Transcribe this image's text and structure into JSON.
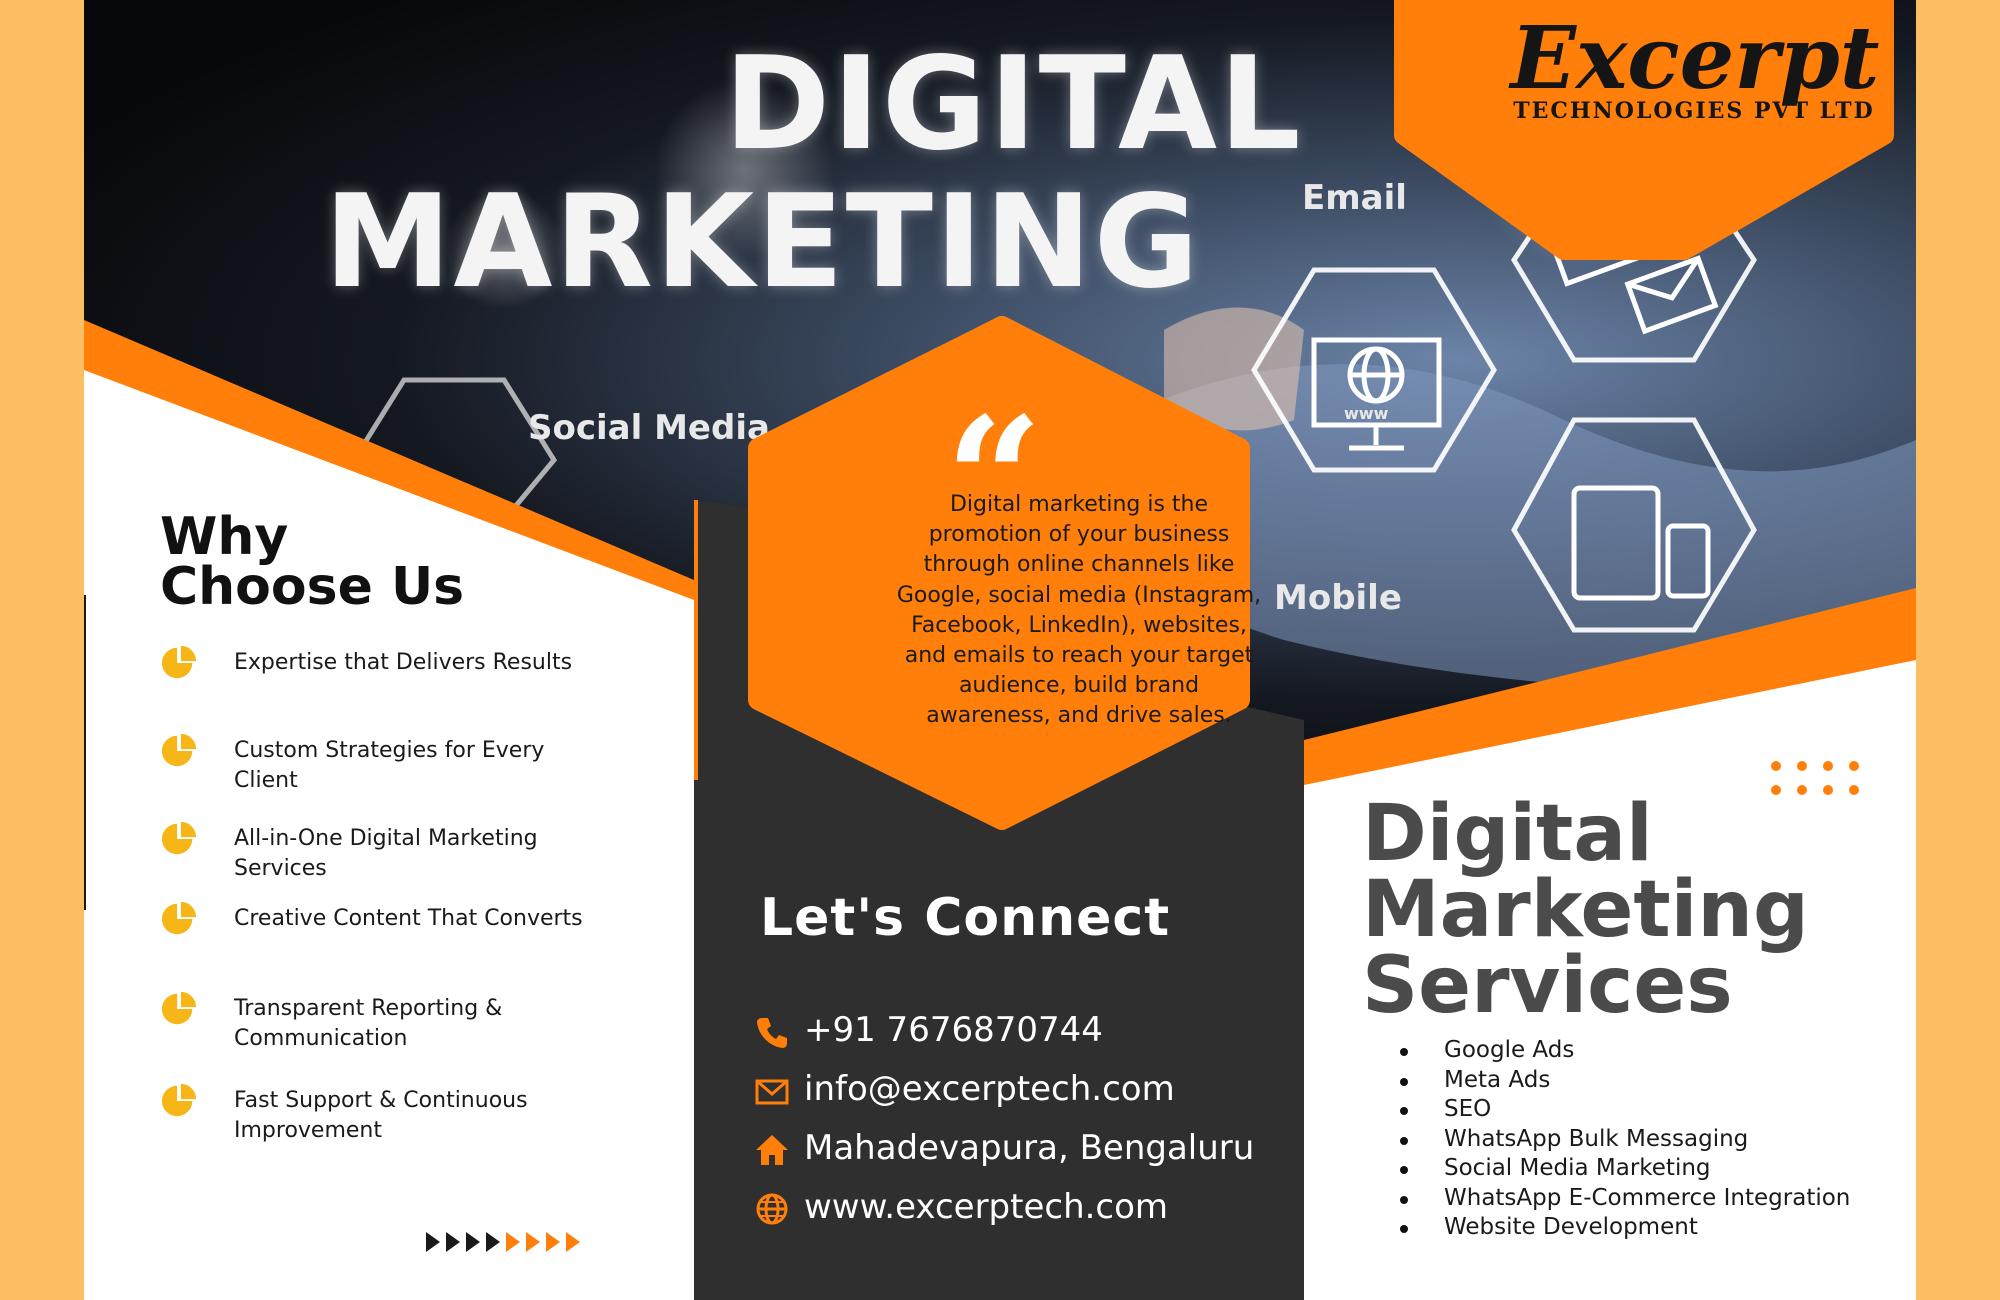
{
  "brand": {
    "logo_title": "Excerpt",
    "logo_subtitle": "TECHNOLOGIES PVT LTD",
    "accent_color": "#ff7f0a",
    "dark_color": "#2f2f2f",
    "yellow_color": "#f7b617"
  },
  "hero": {
    "headline_line1": "DIGITAL",
    "headline_line2": "MARKETING",
    "tags": {
      "email": "Email",
      "social_media": "Social Media",
      "mobile": "Mobile",
      "www": "www"
    }
  },
  "quote": {
    "mark": "“",
    "text": "Digital marketing is the promotion of your business through online channels like Google, social media (Instagram, Facebook, LinkedIn), websites, and emails to reach your target audience, build brand awareness, and drive sales."
  },
  "why_choose_us": {
    "title_line1": "Why",
    "title_line2": "Choose Us",
    "items": [
      {
        "label": "Expertise that Delivers Results",
        "icon": "pie-chart-icon"
      },
      {
        "label": "Custom Strategies for Every Client",
        "icon": "pie-chart-icon"
      },
      {
        "label": "All-in-One Digital Marketing Services",
        "icon": "pie-chart-icon"
      },
      {
        "label": "Creative Content That Converts",
        "icon": "pie-chart-icon"
      },
      {
        "label": "Transparent Reporting & Communication",
        "icon": "pie-chart-icon"
      },
      {
        "label": "Fast Support & Continuous Improvement",
        "icon": "pie-chart-icon"
      }
    ]
  },
  "contact": {
    "title": "Let's Connect",
    "phone": {
      "text": "+91 7676870744",
      "icon": "phone-icon"
    },
    "email": {
      "text": "info@excerptech.com",
      "icon": "mail-icon"
    },
    "address": {
      "text": "Mahadevapura, Bengaluru",
      "icon": "home-icon"
    },
    "website": {
      "text": "www.excerptech.com",
      "icon": "globe-icon"
    }
  },
  "services": {
    "title_line1": "Digital",
    "title_line2": "Marketing",
    "title_line3": "Services",
    "items": [
      "Google Ads",
      "Meta Ads",
      "SEO",
      "WhatsApp Bulk Messaging",
      "Social Media Marketing",
      "WhatsApp E-Commerce Integration",
      "Website Development"
    ]
  }
}
